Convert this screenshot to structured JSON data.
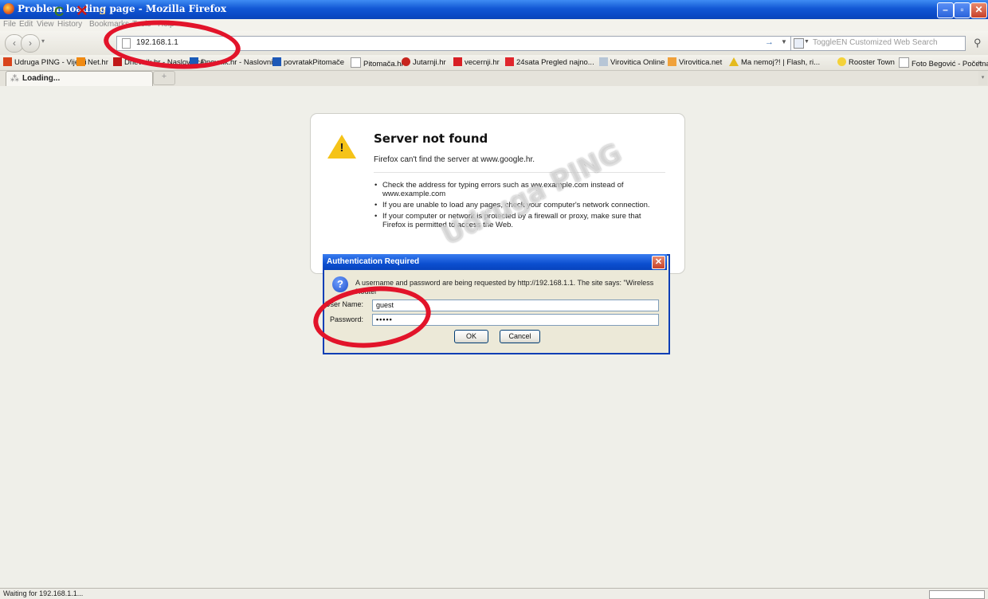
{
  "window": {
    "title": "Problem loading page - Mozilla Firefox"
  },
  "menu": [
    "File",
    "Edit",
    "View",
    "History",
    "Bookmarks",
    "Tools",
    "Help"
  ],
  "nav": {
    "url": "192.168.1.1",
    "search_placeholder": "ToggleEN Customized Web Search"
  },
  "bookmarks": [
    "Udruga PING - Vijesti",
    "Net.hr",
    "Dnevnik.hr - Naslovnica",
    "Dnevnik.hr - Naslovnica",
    "povratakPitomače",
    "Pitomača.hr",
    "Jutarnji.hr",
    "vecernji.hr",
    "24sata Pregled najno...",
    "Virovitica Online",
    "Virovitica.net",
    "Ma nemoj?! | Flash, ri...",
    "Rooster Town",
    "Foto Begović - Početna"
  ],
  "tab": {
    "label": "Loading..."
  },
  "error": {
    "title": "Server not found",
    "desc": "Firefox can't find the server at www.google.hr.",
    "items": [
      "Check the address for typing errors such as ww.example.com instead of www.example.com",
      "If you are unable to load any pages, check your computer's network connection.",
      "If your computer or network is protected by a firewall or proxy, make sure that Firefox is permitted to access the Web."
    ]
  },
  "dialog": {
    "title": "Authentication Required",
    "message": "A username and password are being requested by http://192.168.1.1. The site says: \"Wireless Router\"",
    "username_label": "User Name:",
    "username_value": "guest",
    "password_label": "Password:",
    "password_value": "•••••",
    "ok": "OK",
    "cancel": "Cancel"
  },
  "watermark": "Udruga PING",
  "status": {
    "text": "Waiting for 192.168.1.1..."
  },
  "colors": {
    "titlebar": "#0a49c6",
    "annotation": "#e2142a",
    "warning": "#f5c318"
  }
}
